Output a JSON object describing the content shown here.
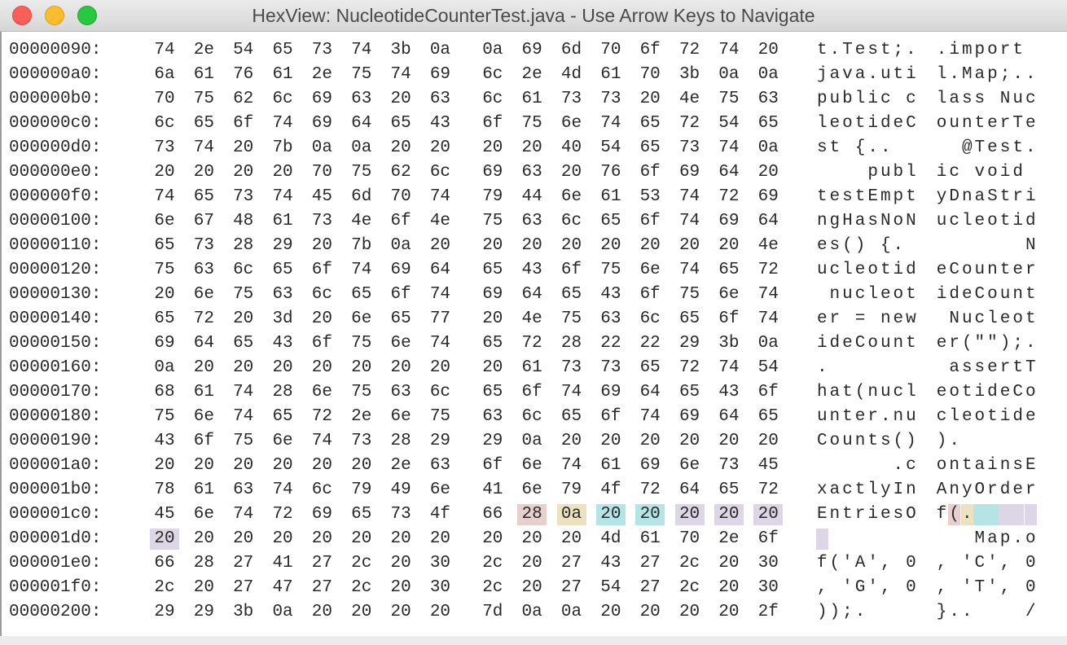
{
  "window": {
    "title": "HexView: NucleotideCounterTest.java - Use Arrow Keys to Navigate"
  },
  "colors": {
    "highlight_pink": "#e6cfcc",
    "highlight_yellow": "#ece2c1",
    "highlight_cyan": "#b4e4e5",
    "highlight_lavender": "#ddd6e6"
  },
  "hex_rows": [
    {
      "address": "00000090:",
      "bytes": [
        "74",
        "2e",
        "54",
        "65",
        "73",
        "74",
        "3b",
        "0a",
        "0a",
        "69",
        "6d",
        "70",
        "6f",
        "72",
        "74",
        "20"
      ],
      "ascii": [
        "t",
        ".",
        "T",
        "e",
        "s",
        "t",
        ";",
        ".",
        ".",
        "i",
        "m",
        "p",
        "o",
        "r",
        "t",
        " "
      ]
    },
    {
      "address": "000000a0:",
      "bytes": [
        "6a",
        "61",
        "76",
        "61",
        "2e",
        "75",
        "74",
        "69",
        "6c",
        "2e",
        "4d",
        "61",
        "70",
        "3b",
        "0a",
        "0a"
      ],
      "ascii": [
        "j",
        "a",
        "v",
        "a",
        ".",
        "u",
        "t",
        "i",
        "l",
        ".",
        "M",
        "a",
        "p",
        ";",
        ".",
        "."
      ]
    },
    {
      "address": "000000b0:",
      "bytes": [
        "70",
        "75",
        "62",
        "6c",
        "69",
        "63",
        "20",
        "63",
        "6c",
        "61",
        "73",
        "73",
        "20",
        "4e",
        "75",
        "63"
      ],
      "ascii": [
        "p",
        "u",
        "b",
        "l",
        "i",
        "c",
        " ",
        "c",
        "l",
        "a",
        "s",
        "s",
        " ",
        "N",
        "u",
        "c"
      ]
    },
    {
      "address": "000000c0:",
      "bytes": [
        "6c",
        "65",
        "6f",
        "74",
        "69",
        "64",
        "65",
        "43",
        "6f",
        "75",
        "6e",
        "74",
        "65",
        "72",
        "54",
        "65"
      ],
      "ascii": [
        "l",
        "e",
        "o",
        "t",
        "i",
        "d",
        "e",
        "C",
        "o",
        "u",
        "n",
        "t",
        "e",
        "r",
        "T",
        "e"
      ]
    },
    {
      "address": "000000d0:",
      "bytes": [
        "73",
        "74",
        "20",
        "7b",
        "0a",
        "0a",
        "20",
        "20",
        "20",
        "20",
        "40",
        "54",
        "65",
        "73",
        "74",
        "0a"
      ],
      "ascii": [
        "s",
        "t",
        " ",
        "{",
        ".",
        ".",
        " ",
        " ",
        " ",
        " ",
        "@",
        "T",
        "e",
        "s",
        "t",
        "."
      ]
    },
    {
      "address": "000000e0:",
      "bytes": [
        "20",
        "20",
        "20",
        "20",
        "70",
        "75",
        "62",
        "6c",
        "69",
        "63",
        "20",
        "76",
        "6f",
        "69",
        "64",
        "20"
      ],
      "ascii": [
        " ",
        " ",
        " ",
        " ",
        "p",
        "u",
        "b",
        "l",
        "i",
        "c",
        " ",
        "v",
        "o",
        "i",
        "d",
        " "
      ]
    },
    {
      "address": "000000f0:",
      "bytes": [
        "74",
        "65",
        "73",
        "74",
        "45",
        "6d",
        "70",
        "74",
        "79",
        "44",
        "6e",
        "61",
        "53",
        "74",
        "72",
        "69"
      ],
      "ascii": [
        "t",
        "e",
        "s",
        "t",
        "E",
        "m",
        "p",
        "t",
        "y",
        "D",
        "n",
        "a",
        "S",
        "t",
        "r",
        "i"
      ]
    },
    {
      "address": "00000100:",
      "bytes": [
        "6e",
        "67",
        "48",
        "61",
        "73",
        "4e",
        "6f",
        "4e",
        "75",
        "63",
        "6c",
        "65",
        "6f",
        "74",
        "69",
        "64"
      ],
      "ascii": [
        "n",
        "g",
        "H",
        "a",
        "s",
        "N",
        "o",
        "N",
        "u",
        "c",
        "l",
        "e",
        "o",
        "t",
        "i",
        "d"
      ]
    },
    {
      "address": "00000110:",
      "bytes": [
        "65",
        "73",
        "28",
        "29",
        "20",
        "7b",
        "0a",
        "20",
        "20",
        "20",
        "20",
        "20",
        "20",
        "20",
        "20",
        "4e"
      ],
      "ascii": [
        "e",
        "s",
        "(",
        ")",
        " ",
        "{",
        ".",
        " ",
        " ",
        " ",
        " ",
        " ",
        " ",
        " ",
        " ",
        "N"
      ]
    },
    {
      "address": "00000120:",
      "bytes": [
        "75",
        "63",
        "6c",
        "65",
        "6f",
        "74",
        "69",
        "64",
        "65",
        "43",
        "6f",
        "75",
        "6e",
        "74",
        "65",
        "72"
      ],
      "ascii": [
        "u",
        "c",
        "l",
        "e",
        "o",
        "t",
        "i",
        "d",
        "e",
        "C",
        "o",
        "u",
        "n",
        "t",
        "e",
        "r"
      ]
    },
    {
      "address": "00000130:",
      "bytes": [
        "20",
        "6e",
        "75",
        "63",
        "6c",
        "65",
        "6f",
        "74",
        "69",
        "64",
        "65",
        "43",
        "6f",
        "75",
        "6e",
        "74"
      ],
      "ascii": [
        " ",
        "n",
        "u",
        "c",
        "l",
        "e",
        "o",
        "t",
        "i",
        "d",
        "e",
        "C",
        "o",
        "u",
        "n",
        "t"
      ]
    },
    {
      "address": "00000140:",
      "bytes": [
        "65",
        "72",
        "20",
        "3d",
        "20",
        "6e",
        "65",
        "77",
        "20",
        "4e",
        "75",
        "63",
        "6c",
        "65",
        "6f",
        "74"
      ],
      "ascii": [
        "e",
        "r",
        " ",
        "=",
        " ",
        "n",
        "e",
        "w",
        " ",
        "N",
        "u",
        "c",
        "l",
        "e",
        "o",
        "t"
      ]
    },
    {
      "address": "00000150:",
      "bytes": [
        "69",
        "64",
        "65",
        "43",
        "6f",
        "75",
        "6e",
        "74",
        "65",
        "72",
        "28",
        "22",
        "22",
        "29",
        "3b",
        "0a"
      ],
      "ascii": [
        "i",
        "d",
        "e",
        "C",
        "o",
        "u",
        "n",
        "t",
        "e",
        "r",
        "(",
        "\"",
        "\"",
        ")",
        ";",
        "."
      ]
    },
    {
      "address": "00000160:",
      "bytes": [
        "0a",
        "20",
        "20",
        "20",
        "20",
        "20",
        "20",
        "20",
        "20",
        "61",
        "73",
        "73",
        "65",
        "72",
        "74",
        "54"
      ],
      "ascii": [
        ".",
        " ",
        " ",
        " ",
        " ",
        " ",
        " ",
        " ",
        " ",
        "a",
        "s",
        "s",
        "e",
        "r",
        "t",
        "T"
      ]
    },
    {
      "address": "00000170:",
      "bytes": [
        "68",
        "61",
        "74",
        "28",
        "6e",
        "75",
        "63",
        "6c",
        "65",
        "6f",
        "74",
        "69",
        "64",
        "65",
        "43",
        "6f"
      ],
      "ascii": [
        "h",
        "a",
        "t",
        "(",
        "n",
        "u",
        "c",
        "l",
        "e",
        "o",
        "t",
        "i",
        "d",
        "e",
        "C",
        "o"
      ]
    },
    {
      "address": "00000180:",
      "bytes": [
        "75",
        "6e",
        "74",
        "65",
        "72",
        "2e",
        "6e",
        "75",
        "63",
        "6c",
        "65",
        "6f",
        "74",
        "69",
        "64",
        "65"
      ],
      "ascii": [
        "u",
        "n",
        "t",
        "e",
        "r",
        ".",
        "n",
        "u",
        "c",
        "l",
        "e",
        "o",
        "t",
        "i",
        "d",
        "e"
      ]
    },
    {
      "address": "00000190:",
      "bytes": [
        "43",
        "6f",
        "75",
        "6e",
        "74",
        "73",
        "28",
        "29",
        "29",
        "0a",
        "20",
        "20",
        "20",
        "20",
        "20",
        "20"
      ],
      "ascii": [
        "C",
        "o",
        "u",
        "n",
        "t",
        "s",
        "(",
        ")",
        ")",
        ".",
        " ",
        " ",
        " ",
        " ",
        " ",
        " "
      ]
    },
    {
      "address": "000001a0:",
      "bytes": [
        "20",
        "20",
        "20",
        "20",
        "20",
        "20",
        "2e",
        "63",
        "6f",
        "6e",
        "74",
        "61",
        "69",
        "6e",
        "73",
        "45"
      ],
      "ascii": [
        " ",
        " ",
        " ",
        " ",
        " ",
        " ",
        ".",
        "c",
        "o",
        "n",
        "t",
        "a",
        "i",
        "n",
        "s",
        "E"
      ]
    },
    {
      "address": "000001b0:",
      "bytes": [
        "78",
        "61",
        "63",
        "74",
        "6c",
        "79",
        "49",
        "6e",
        "41",
        "6e",
        "79",
        "4f",
        "72",
        "64",
        "65",
        "72"
      ],
      "ascii": [
        "x",
        "a",
        "c",
        "t",
        "l",
        "y",
        "I",
        "n",
        "A",
        "n",
        "y",
        "O",
        "r",
        "d",
        "e",
        "r"
      ]
    },
    {
      "address": "000001c0:",
      "bytes": [
        "45",
        "6e",
        "74",
        "72",
        "69",
        "65",
        "73",
        "4f",
        "66",
        "28",
        "0a",
        "20",
        "20",
        "20",
        "20",
        "20"
      ],
      "ascii": [
        "E",
        "n",
        "t",
        "r",
        "i",
        "e",
        "s",
        "O",
        "f",
        "(",
        ".",
        " ",
        " ",
        " ",
        " ",
        " "
      ]
    },
    {
      "address": "000001d0:",
      "bytes": [
        "20",
        "20",
        "20",
        "20",
        "20",
        "20",
        "20",
        "20",
        "20",
        "20",
        "20",
        "4d",
        "61",
        "70",
        "2e",
        "6f"
      ],
      "ascii": [
        " ",
        " ",
        " ",
        " ",
        " ",
        " ",
        " ",
        " ",
        " ",
        " ",
        " ",
        "M",
        "a",
        "p",
        ".",
        "o"
      ]
    },
    {
      "address": "000001e0:",
      "bytes": [
        "66",
        "28",
        "27",
        "41",
        "27",
        "2c",
        "20",
        "30",
        "2c",
        "20",
        "27",
        "43",
        "27",
        "2c",
        "20",
        "30"
      ],
      "ascii": [
        "f",
        "(",
        "'",
        "A",
        "'",
        ",",
        " ",
        "0",
        ",",
        " ",
        "'",
        "C",
        "'",
        ",",
        " ",
        "0"
      ]
    },
    {
      "address": "000001f0:",
      "bytes": [
        "2c",
        "20",
        "27",
        "47",
        "27",
        "2c",
        "20",
        "30",
        "2c",
        "20",
        "27",
        "54",
        "27",
        "2c",
        "20",
        "30"
      ],
      "ascii": [
        ",",
        " ",
        "'",
        "G",
        "'",
        ",",
        " ",
        "0",
        ",",
        " ",
        "'",
        "T",
        "'",
        ",",
        " ",
        "0"
      ]
    },
    {
      "address": "00000200:",
      "bytes": [
        "29",
        "29",
        "3b",
        "0a",
        "20",
        "20",
        "20",
        "20",
        "7d",
        "0a",
        "0a",
        "20",
        "20",
        "20",
        "20",
        "2f"
      ],
      "ascii": [
        ")",
        ")",
        ";",
        ".",
        " ",
        " ",
        " ",
        " ",
        "}",
        ".",
        ".",
        " ",
        " ",
        " ",
        " ",
        "/"
      ]
    }
  ],
  "highlights": [
    {
      "row": 19,
      "col": 9,
      "color": "highlight_pink"
    },
    {
      "row": 19,
      "col": 10,
      "color": "highlight_yellow"
    },
    {
      "row": 19,
      "col": 11,
      "color": "highlight_cyan"
    },
    {
      "row": 19,
      "col": 12,
      "color": "highlight_cyan"
    },
    {
      "row": 19,
      "col": 13,
      "color": "highlight_lavender"
    },
    {
      "row": 19,
      "col": 14,
      "color": "highlight_lavender"
    },
    {
      "row": 19,
      "col": 15,
      "color": "highlight_lavender"
    },
    {
      "row": 20,
      "col": 0,
      "color": "highlight_lavender"
    }
  ]
}
